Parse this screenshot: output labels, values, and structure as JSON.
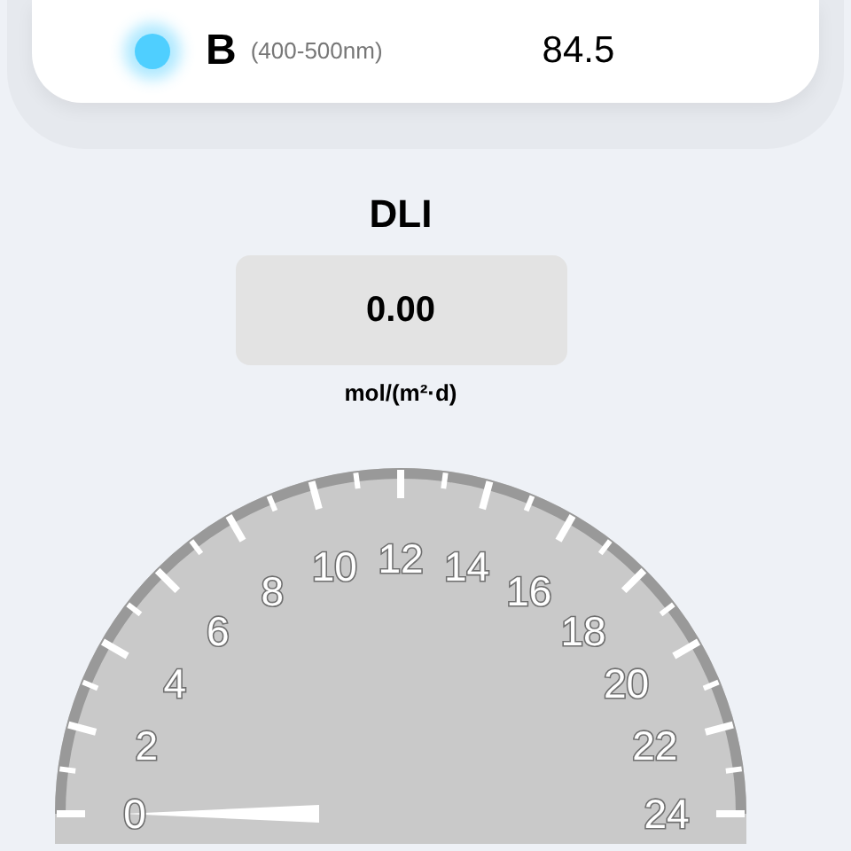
{
  "channel": {
    "name": "B",
    "range": "(400-500nm)",
    "value": "84.5",
    "color": "#4fcfff"
  },
  "dli": {
    "title": "DLI",
    "value": "0.00",
    "unit": "mol/(m²·d)"
  },
  "gauge": {
    "scale": [
      {
        "label": "0"
      },
      {
        "label": "2"
      },
      {
        "label": "4"
      },
      {
        "label": "6"
      },
      {
        "label": "8"
      },
      {
        "label": "10"
      },
      {
        "label": "12"
      },
      {
        "label": "14"
      },
      {
        "label": "16"
      },
      {
        "label": "18"
      },
      {
        "label": "20"
      },
      {
        "label": "22"
      },
      {
        "label": "24"
      }
    ]
  }
}
